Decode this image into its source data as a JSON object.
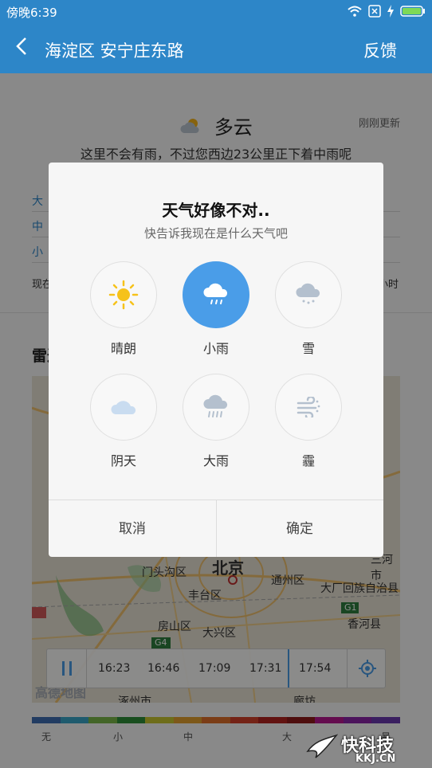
{
  "status_bar": {
    "time": "傍晚6:39"
  },
  "header": {
    "back_icon": "chevron-left-icon",
    "title": "海淀区 安宁庄东路",
    "feedback": "反馈"
  },
  "weather": {
    "condition": "多云",
    "updated": "刚刚更新",
    "forecast": "这里不会有雨，不过您西边23公里正下着中雨呢"
  },
  "intensity_labels": [
    "大",
    "中",
    "小"
  ],
  "row_left": "现在",
  "row_right": "小时",
  "radar": {
    "title": "雷达",
    "map_labels": [
      "北京",
      "门头沟区",
      "丰台区",
      "通州区",
      "大厂回族自治县",
      "三河市",
      "香河县",
      "房山区",
      "大兴区",
      "涿州市",
      "廊坊",
      "高德地图",
      "G1",
      "G4"
    ],
    "timeline": {
      "ticks": [
        "16:23",
        "16:46",
        "17:09",
        "17:31",
        "17:54"
      ]
    },
    "legend": [
      "无",
      "小",
      "中",
      "大",
      "暴"
    ],
    "legend_colors": [
      "#3f6db3",
      "#3aa6c9",
      "#7ab94a",
      "#2e8f3a",
      "#c9c630",
      "#e3a12f",
      "#e06f2a",
      "#d4402a",
      "#b3231f",
      "#8e1b1b",
      "#b6178f",
      "#8a25a8",
      "#6a3ab0"
    ]
  },
  "dialog": {
    "title": "天气好像不对..",
    "subtitle": "快告诉我现在是什么天气吧",
    "options": [
      {
        "label": "晴朗",
        "icon": "sun-icon",
        "selected": false
      },
      {
        "label": "小雨",
        "icon": "light-rain-icon",
        "selected": true
      },
      {
        "label": "雪",
        "icon": "snow-icon",
        "selected": false
      },
      {
        "label": "阴天",
        "icon": "cloud-icon",
        "selected": false
      },
      {
        "label": "大雨",
        "icon": "heavy-rain-icon",
        "selected": false
      },
      {
        "label": "霾",
        "icon": "haze-icon",
        "selected": false
      }
    ],
    "cancel": "取消",
    "confirm": "确定"
  },
  "watermark": {
    "brand": "快科技",
    "site": "KKJ.CN"
  },
  "colors": {
    "primary": "#2d86c8",
    "selected": "#4a9de8"
  }
}
